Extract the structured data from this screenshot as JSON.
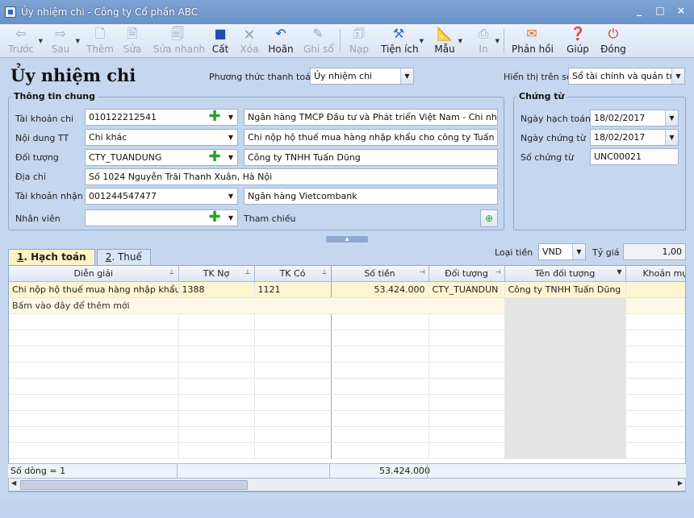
{
  "window": {
    "title": "Ủy nhiệm chi - Công ty Cổ phần ABC",
    "minimize": "_",
    "maximize": "□",
    "close": "×"
  },
  "toolbar": {
    "prev": "Trước",
    "next": "Sau",
    "add": "Thêm",
    "edit": "Sửa",
    "quick_edit": "Sửa nhanh",
    "save": "Cất",
    "delete": "Xóa",
    "undo": "Hoãn",
    "post": "Ghi sổ",
    "load": "Nạp",
    "utilities": "Tiện ích",
    "template": "Mẫu",
    "print": "In",
    "feedback": "Phản hồi",
    "help": "Giúp",
    "close": "Đóng"
  },
  "header": {
    "title": "Ủy nhiệm chi",
    "payment_method_label": "Phương thức thanh toán",
    "payment_method_value": "Ủy nhiệm chi",
    "display_on_label": "Hiển thị trên sổ",
    "display_on_value": "Sổ tài chính và quản trị"
  },
  "general": {
    "group_title": "Thông tin chung",
    "account_label": "Tài khoản chi",
    "account_value": "010122212541",
    "bank_name": "Ngân hàng TMCP Đầu tư và Phát triển Việt Nam - Chi nhánh",
    "content_label": "Nội dung TT",
    "content_value": "Chi khác",
    "content_desc": "Chi nộp hộ thuế mua hàng nhập khẩu cho công ty Tuấn Dũn",
    "object_label": "Đối tượng",
    "object_value": "CTY_TUANDUNG",
    "object_name": "Công ty TNHH Tuấn Dũng",
    "address_label": "Địa chỉ",
    "address_value": "Số 1024 Nguyễn Trãi Thanh Xuân, Hà Nội",
    "receiver_account_label": "Tài khoản nhận",
    "receiver_account_value": "001244547477",
    "receiver_bank": "Ngân hàng Vietcombank",
    "employee_label": "Nhân viên",
    "employee_value": "",
    "reference_label": "Tham chiếu"
  },
  "voucher": {
    "group_title": "Chứng từ",
    "posting_date_label": "Ngày hạch toán",
    "posting_date_value": "18/02/2017",
    "voucher_date_label": "Ngày chứng từ",
    "voucher_date_value": "18/02/2017",
    "voucher_no_label": "Số chứng từ",
    "voucher_no_value": "UNC00021"
  },
  "tabs": [
    {
      "num": "1",
      "label": ". Hạch toán"
    },
    {
      "num": "2",
      "label": ". Thuế"
    }
  ],
  "currency": {
    "label": "Loại tiền",
    "value": "VND",
    "rate_label": "Tỷ giá",
    "rate_value": "1,00"
  },
  "grid": {
    "columns": [
      "Diễn giải",
      "TK Nợ",
      "TK Có",
      "Số tiền",
      "Đối tượng",
      "Tên đối tượng",
      "Khoản mục C"
    ],
    "rows": [
      [
        "Chi nộp hộ thuế mua hàng nhập khẩu c",
        "1388",
        "1121",
        "53.424.000",
        "CTY_TUANDUN",
        "Công ty TNHH Tuấn Dũng",
        ""
      ]
    ],
    "add_row_text": "Bấm vào đây để thêm mới",
    "row_count": "Số dòng = 1",
    "total": "53.424.000"
  }
}
